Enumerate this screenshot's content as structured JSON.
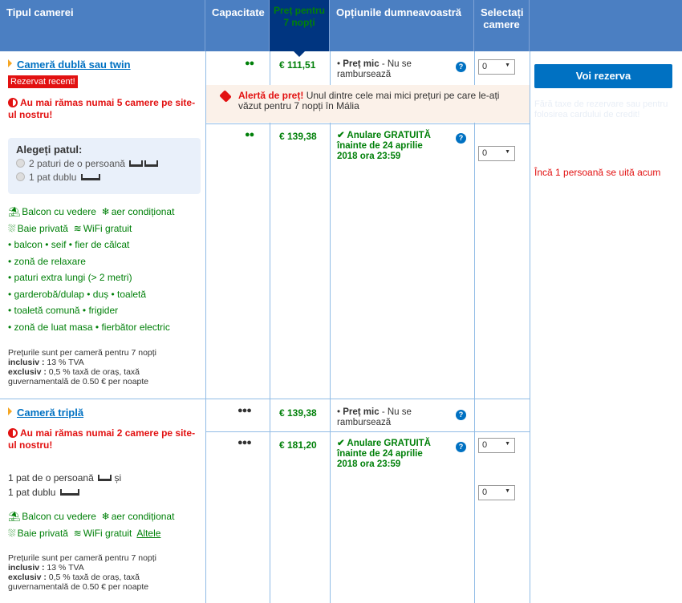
{
  "header": {
    "room_type": "Tipul camerei",
    "capacity": "Capacitate",
    "price": "Preț pentru 7 nopți",
    "options": "Opțiunile dumneavoastră",
    "select": "Selectați camere"
  },
  "room1": {
    "name": "Cameră dublă sau twin",
    "badge": "Rezervat recent!",
    "scarcity": "Au mai rămas numai 5 camere pe site-ul nostru!",
    "bed_title": "Alegeți patul:",
    "bed_opt1": "2 paturi de o persoană",
    "bed_opt2": "1 pat dublu",
    "fac_balcony_view": "Balcon cu vedere",
    "fac_ac": "aer condiționat",
    "fac_bath": "Baie privată",
    "fac_wifi": "WiFi gratuit",
    "amenity_line1": "• balcon   • seif   • fier de călcat",
    "amenity_line2": "• zonă de relaxare",
    "amenity_line3": "• paturi extra lungi (> 2 metri)",
    "amenity_line4": "• garderobă/dulap   • duș   • toaletă",
    "amenity_line5": "• toaletă comună   • frigider",
    "amenity_line6": "• zonă de luat masa   • fierbător electric",
    "note_line1": "Prețurile sunt per cameră pentru 7 nopți",
    "note_incl_label": "inclusiv :",
    "note_incl_val": " 13 % TVA",
    "note_excl_label": "exclusiv :",
    "note_excl_val": " 0,5 % taxă de oraș, taxă guvernamentală de 0.50 € per noapte",
    "opt1_price": "€ 111,51",
    "opt1_policy_bold": "Preț mic",
    "opt1_policy_rest": " - Nu se rambursează",
    "opt1_select": "0",
    "alert_bold": "Alertă de preț!",
    "alert_rest": " Unul dintre cele mai mici prețuri pe care le-ați văzut pentru 7 nopți în Mália",
    "opt2_price": "€ 139,38",
    "opt2_policy": "Anulare GRATUITĂ înainte de 24 aprilie 2018 ora 23:59",
    "opt2_select": "0"
  },
  "room2": {
    "name": "Cameră triplă",
    "scarcity": "Au mai rămas numai 2 camere pe site-ul nostru!",
    "bed_line1": "1 pat de o persoană",
    "bed_and": " și",
    "bed_line2": "1 pat dublu",
    "fac_balcony_view": "Balcon cu vedere",
    "fac_ac": "aer condiționat",
    "fac_bath": "Baie privată",
    "fac_wifi": "WiFi gratuit",
    "fac_more": "Altele",
    "note_line1": "Prețurile sunt per cameră pentru 7 nopți",
    "note_incl_label": "inclusiv :",
    "note_incl_val": " 13 % TVA",
    "note_excl_label": "exclusiv :",
    "note_excl_val": " 0,5 % taxă de oraș, taxă guvernamentală de 0.50 € per noapte",
    "opt1_price": "€ 139,38",
    "opt1_policy_bold": "Preț mic",
    "opt1_policy_rest": " - Nu se rambursează",
    "opt1_select": "0",
    "opt2_price": "€ 181,20",
    "opt2_policy": "Anulare GRATUITĂ înainte de 24 aprilie 2018 ora 23:59",
    "opt2_select": "0"
  },
  "sidebar": {
    "reserve_button": "Voi rezerva",
    "faint_text": "Fără taxe de rezervare sau pentru folosirea cardului de credit!",
    "viewers": "Încă 1 persoană se uită acum"
  },
  "colors": {
    "header_blue": "#4b7fc2",
    "price_header": "#003580",
    "green": "#008009",
    "red": "#e21111",
    "link": "#0071c2"
  }
}
